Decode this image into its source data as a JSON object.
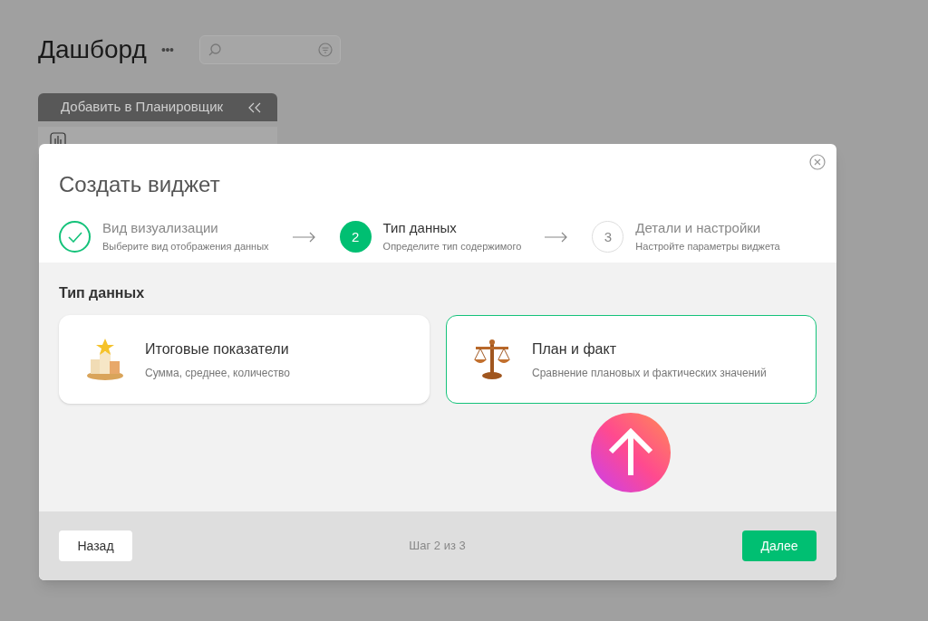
{
  "page": {
    "title": "Дашборд",
    "menu": "•••"
  },
  "planner": {
    "header": "Добавить в Планировщик"
  },
  "dialog": {
    "title": "Создать виджет",
    "steps": [
      {
        "kind": "done",
        "title": "Вид визуализации",
        "subtitle": "Выберите вид отображения данных"
      },
      {
        "kind": "current",
        "number": "2",
        "title": "Тип данных",
        "subtitle": "Определите тип содержимого"
      },
      {
        "kind": "pending",
        "number": "3",
        "title": "Детали и настройки",
        "subtitle": "Настройте параметры виджета"
      }
    ],
    "section_title": "Тип данных",
    "options": [
      {
        "kind": "podium",
        "title": "Итоговые показатели",
        "subtitle": "Сумма, среднее, количество",
        "selected": false
      },
      {
        "kind": "scales",
        "title": "План и факт",
        "subtitle": "Сравнение плановых и фактических значений",
        "selected": true
      }
    ],
    "back": "Назад",
    "progress": "Шаг 2 из 3",
    "next": "Далее"
  }
}
